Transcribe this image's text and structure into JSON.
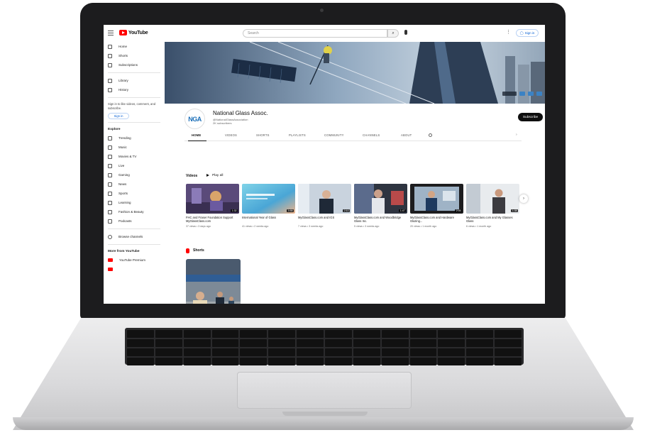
{
  "header": {
    "logo_text": "YouTube",
    "search_placeholder": "Search",
    "sign_in": "Sign in"
  },
  "sidebar": {
    "main": [
      {
        "label": "Home",
        "icon": "home-icon"
      },
      {
        "label": "Shorts",
        "icon": "shorts-icon"
      },
      {
        "label": "Subscriptions",
        "icon": "subscriptions-icon"
      }
    ],
    "library": [
      {
        "label": "Library",
        "icon": "library-icon"
      },
      {
        "label": "History",
        "icon": "history-icon"
      }
    ],
    "signin_prompt": "Sign in to like videos, comment, and subscribe.",
    "signin_button": "Sign in",
    "explore_heading": "Explore",
    "explore": [
      {
        "label": "Trending",
        "icon": "trending-icon"
      },
      {
        "label": "Music",
        "icon": "music-icon"
      },
      {
        "label": "Movies & TV",
        "icon": "movies-icon"
      },
      {
        "label": "Live",
        "icon": "live-icon"
      },
      {
        "label": "Gaming",
        "icon": "gaming-icon"
      },
      {
        "label": "News",
        "icon": "news-icon"
      },
      {
        "label": "Sports",
        "icon": "sports-icon"
      },
      {
        "label": "Learning",
        "icon": "learning-icon"
      },
      {
        "label": "Fashion & Beauty",
        "icon": "fashion-icon"
      },
      {
        "label": "Podcasts",
        "icon": "podcasts-icon"
      }
    ],
    "browse_channels": "Browse channels",
    "more_heading": "More from YouTube",
    "more": [
      {
        "label": "YouTube Premium"
      }
    ]
  },
  "channel": {
    "avatar_text": "NGA",
    "name": "National Glass Assoc.",
    "handle": "@NationalGlassAssociation",
    "subscribers": "2K subscribers",
    "subscribe": "Subscribe"
  },
  "tabs": [
    "HOME",
    "VIDEOS",
    "SHORTS",
    "PLAYLISTS",
    "COMMUNITY",
    "CHANNELS",
    "ABOUT"
  ],
  "videos_section": {
    "title": "Videos",
    "play_all": "Play all",
    "items": [
      {
        "title": "FHC and Fraser Foundation Support MyGlassClass.com",
        "meta": "37 views • 3 days ago",
        "duration": "1:32"
      },
      {
        "title": "International Year of Glass",
        "meta": "41 views • 2 weeks ago",
        "duration": "0:58"
      },
      {
        "title": "MyGlassClass.com and IGS",
        "meta": "7 views • 3 weeks ago",
        "duration": "2:10"
      },
      {
        "title": "MyGlassClass.com and Woodbridge Glass Inc.",
        "meta": "5 views • 3 weeks ago",
        "duration": "1:47"
      },
      {
        "title": "MyGlassClass.com and Hardware Glazing...",
        "meta": "20 views • 1 month ago",
        "duration": "2:05"
      },
      {
        "title": "MyGlassClass.com and My Glasses Glass",
        "meta": "6 views • 1 month ago",
        "duration": "1:38"
      }
    ]
  },
  "shorts_section": {
    "title": "Shorts"
  }
}
